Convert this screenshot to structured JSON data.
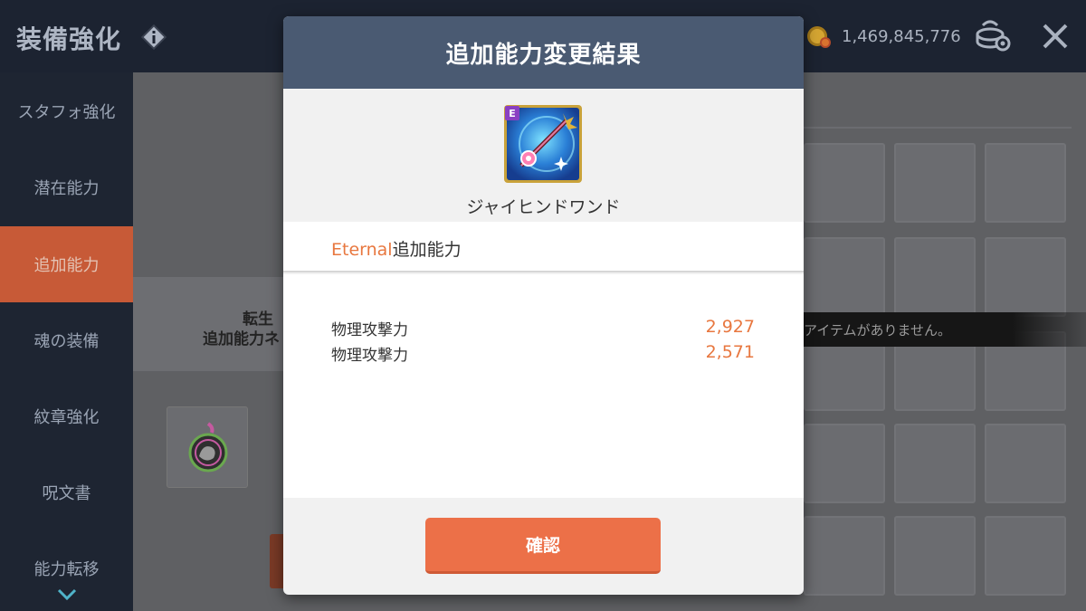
{
  "header": {
    "title": "装備強化",
    "currency": "1,469,845,776"
  },
  "sidebar": {
    "items": [
      {
        "label": "スタフォ強化"
      },
      {
        "label": "潜在能力"
      },
      {
        "label": "追加能力",
        "active": true
      },
      {
        "label": "魂の装備"
      },
      {
        "label": "紋章強化"
      },
      {
        "label": "呪文書"
      },
      {
        "label": "能力転移"
      }
    ]
  },
  "background": {
    "label_line1": "転生",
    "label_line2": "追加能力ネ",
    "toast": "アイテムがありません。"
  },
  "modal": {
    "title": "追加能力変更結果",
    "item": {
      "grade_badge": "E",
      "name": "ジャイヒンドワンド",
      "icon": "wand-icon"
    },
    "section": {
      "grade": "Eternal",
      "label": "追加能力"
    },
    "stats": [
      {
        "name": "物理攻撃力",
        "value": "2,927"
      },
      {
        "name": "物理攻撃力",
        "value": "2,571"
      }
    ],
    "confirm_label": "確認"
  },
  "colors": {
    "header_bg": "#4a5a72",
    "accent_orange": "#e8773f",
    "button": "#ec7048",
    "sidebar_active": "#c75a37"
  }
}
